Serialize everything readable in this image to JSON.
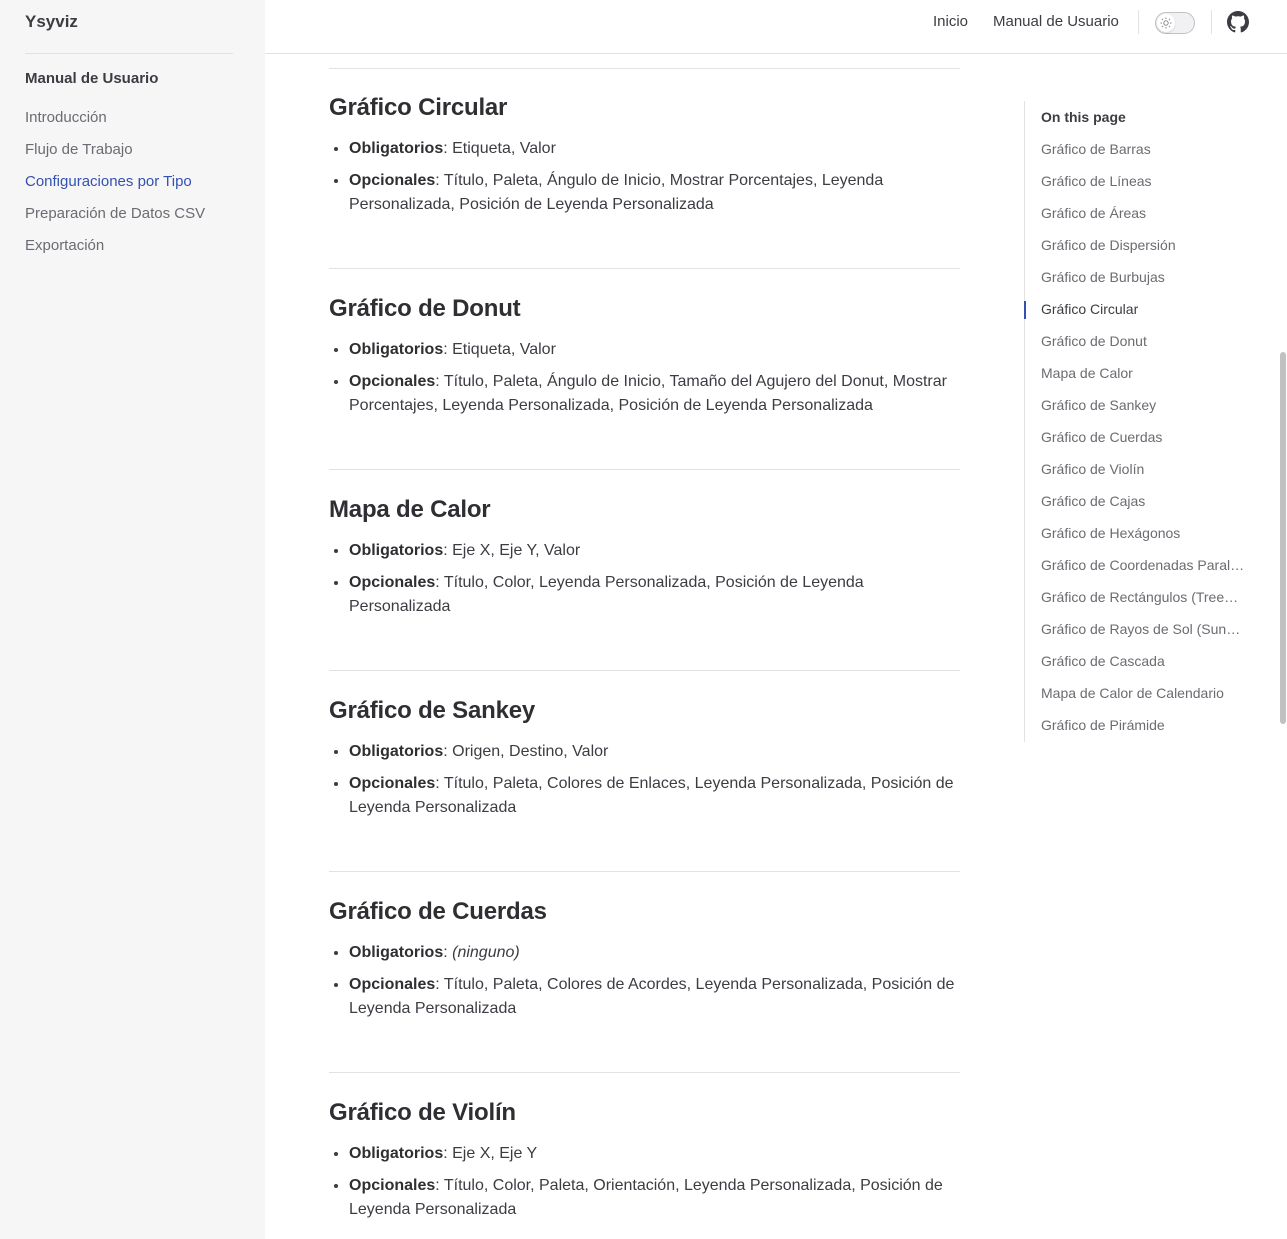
{
  "brand": {
    "title": "Ysyviz"
  },
  "topnav": {
    "home": "Inicio",
    "manual": "Manual de Usuario"
  },
  "sidebar": {
    "section": "Manual de Usuario",
    "items": [
      "Introducción",
      "Flujo de Trabajo",
      "Configuraciones por Tipo",
      "Preparación de Datos CSV",
      "Exportación"
    ],
    "active_index": 2
  },
  "labels": {
    "required": "Obligatorios",
    "optional": "Opcionales"
  },
  "sections": [
    {
      "title": "Gráfico Circular",
      "required": "Etiqueta, Valor",
      "optional": "Título, Paleta, Ángulo de Inicio, Mostrar Porcentajes, Leyenda Personalizada, Posición de Leyenda Personalizada"
    },
    {
      "title": "Gráfico de Donut",
      "required": "Etiqueta, Valor",
      "optional": "Título, Paleta, Ángulo de Inicio, Tamaño del Agujero del Donut, Mostrar Porcentajes, Leyenda Personalizada, Posición de Leyenda Personalizada"
    },
    {
      "title": "Mapa de Calor",
      "required": "Eje X, Eje Y, Valor",
      "optional": "Título, Color, Leyenda Personalizada, Posición de Leyenda Personalizada"
    },
    {
      "title": "Gráfico de Sankey",
      "required": "Origen, Destino, Valor",
      "optional": "Título, Paleta, Colores de Enlaces, Leyenda Personalizada, Posición de Leyenda Personalizada"
    },
    {
      "title": "Gráfico de Cuerdas",
      "required": "(ninguno)",
      "optional": "Título, Paleta, Colores de Acordes, Leyenda Personalizada, Posición de Leyenda Personalizada"
    },
    {
      "title": "Gráfico de Violín",
      "required": "Eje X, Eje Y",
      "optional": "Título, Color, Paleta, Orientación, Leyenda Personalizada, Posición de Leyenda Personalizada"
    }
  ],
  "toc": {
    "title": "On this page",
    "items": [
      "Gráfico de Barras",
      "Gráfico de Líneas",
      "Gráfico de Áreas",
      "Gráfico de Dispersión",
      "Gráfico de Burbujas",
      "Gráfico Circular",
      "Gráfico de Donut",
      "Mapa de Calor",
      "Gráfico de Sankey",
      "Gráfico de Cuerdas",
      "Gráfico de Violín",
      "Gráfico de Cajas",
      "Gráfico de Hexágonos",
      "Gráfico de Coordenadas Paralelas",
      "Gráfico de Rectángulos (Treemap)",
      "Gráfico de Rayos de Sol (Sunburst)",
      "Gráfico de Cascada",
      "Mapa de Calor de Calendario",
      "Gráfico de Pirámide"
    ],
    "active_index": 5
  },
  "colors": {
    "accent": "#3451b2",
    "sidebar_bg": "#f6f6f7",
    "divider": "#e2e2e3"
  }
}
